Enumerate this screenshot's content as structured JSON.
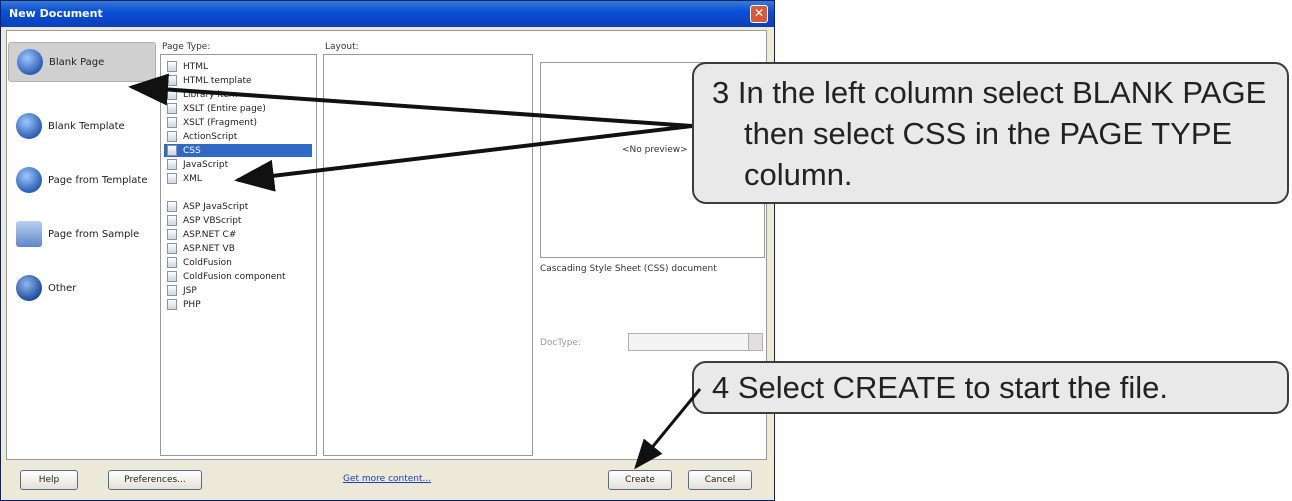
{
  "window": {
    "title": "New Document",
    "close_icon": "close-icon"
  },
  "categories": [
    {
      "label": "Blank Page",
      "icon": "blank-page-icon",
      "selected": true
    },
    {
      "label": "Blank Template",
      "icon": "blank-template-icon",
      "selected": false
    },
    {
      "label": "Page from Template",
      "icon": "page-from-template-icon",
      "selected": false
    },
    {
      "label": "Page from Sample",
      "icon": "page-from-sample-icon",
      "selected": false
    },
    {
      "label": "Other",
      "icon": "other-icon",
      "selected": false
    }
  ],
  "columns": {
    "page_type": "Page Type:",
    "layout": "Layout:"
  },
  "page_types": [
    "HTML",
    "HTML template",
    "Library item",
    "XSLT (Entire page)",
    "XSLT (Fragment)",
    "ActionScript",
    "CSS",
    "JavaScript",
    "XML",
    "",
    "ASP JavaScript",
    "ASP VBScript",
    "ASP.NET C#",
    "ASP.NET VB",
    "ColdFusion",
    "ColdFusion component",
    "JSP",
    "PHP"
  ],
  "selected_page_type": "CSS",
  "preview": {
    "text": "<No preview>"
  },
  "description": "Cascading Style Sheet (CSS) document",
  "doctype": {
    "label": "DocType:",
    "value": ""
  },
  "buttons": {
    "help": "Help",
    "preferences": "Preferences...",
    "create": "Create",
    "cancel": "Cancel"
  },
  "link": "Get more content...",
  "callouts": {
    "step3_line1": "3  In the left column select BLANK PAGE",
    "step3_line2": "then select CSS in the PAGE TYPE",
    "step3_line3": "column.",
    "step4": "4  Select CREATE to start the file."
  },
  "colors": {
    "titlebar": "#0a4fd8",
    "selection": "#316ac5",
    "callout_bg": "#e9e9e9"
  }
}
